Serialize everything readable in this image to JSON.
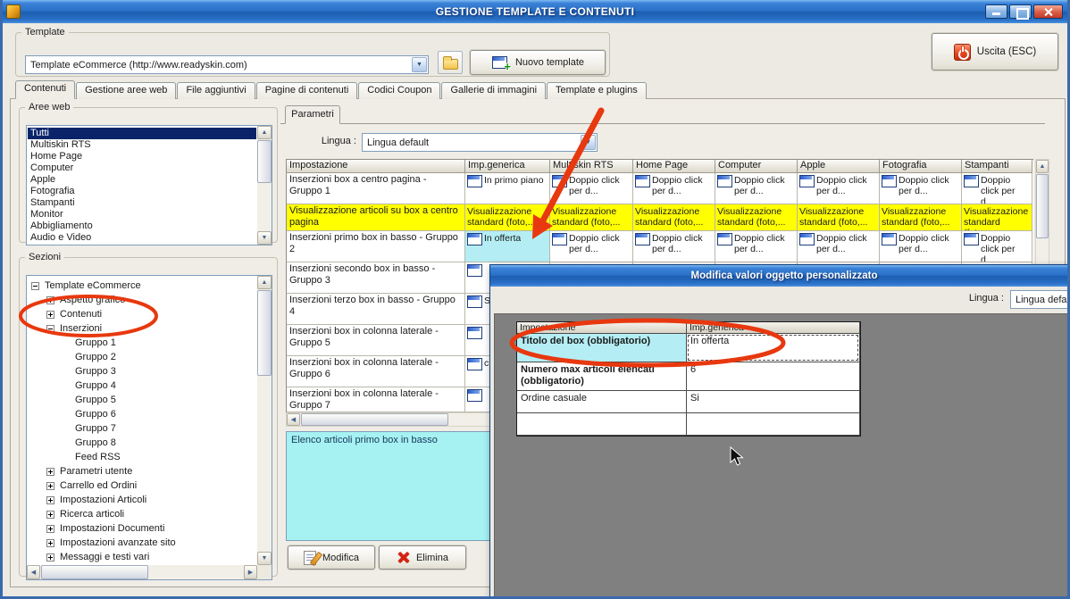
{
  "window": {
    "title": "GESTIONE TEMPLATE E CONTENUTI"
  },
  "toolbar": {
    "template_label": "Template",
    "template_value": "Template eCommerce (http://www.readyskin.com)",
    "new_template_label": "Nuovo template",
    "exit_label": "Uscita (ESC)"
  },
  "tabs": [
    "Contenuti",
    "Gestione aree web",
    "File aggiuntivi",
    "Pagine di contenuti",
    "Codici Coupon",
    "Gallerie di immagini",
    "Template e plugins"
  ],
  "active_tab": "Contenuti",
  "aree_web": {
    "legend": "Aree web",
    "selected": "Tutti",
    "items": [
      "Tutti",
      "Multiskin RTS",
      "Home Page",
      "Computer",
      "Apple",
      "Fotografia",
      "Stampanti",
      "Monitor",
      "Abbigliamento",
      "Audio e Video"
    ]
  },
  "sezioni": {
    "legend": "Sezioni",
    "tree": [
      {
        "label": "Template eCommerce",
        "level": 0,
        "toggle": "-"
      },
      {
        "label": "Aspetto grafico",
        "level": 1,
        "toggle": "+"
      },
      {
        "label": "Contenuti",
        "level": 1,
        "toggle": "+"
      },
      {
        "label": "Inserzioni",
        "level": 1,
        "toggle": "-"
      },
      {
        "label": "Gruppo 1",
        "level": 2,
        "toggle": ""
      },
      {
        "label": "Gruppo 2",
        "level": 2,
        "toggle": ""
      },
      {
        "label": "Gruppo 3",
        "level": 2,
        "toggle": ""
      },
      {
        "label": "Gruppo 4",
        "level": 2,
        "toggle": ""
      },
      {
        "label": "Gruppo 5",
        "level": 2,
        "toggle": ""
      },
      {
        "label": "Gruppo 6",
        "level": 2,
        "toggle": ""
      },
      {
        "label": "Gruppo 7",
        "level": 2,
        "toggle": ""
      },
      {
        "label": "Gruppo 8",
        "level": 2,
        "toggle": ""
      },
      {
        "label": "Feed RSS",
        "level": 2,
        "toggle": ""
      },
      {
        "label": "Parametri utente",
        "level": 1,
        "toggle": "+"
      },
      {
        "label": "Carrello ed Ordini",
        "level": 1,
        "toggle": "+"
      },
      {
        "label": "Impostazioni Articoli",
        "level": 1,
        "toggle": "+"
      },
      {
        "label": "Ricerca articoli",
        "level": 1,
        "toggle": "+"
      },
      {
        "label": "Impostazioni Documenti",
        "level": 1,
        "toggle": "+"
      },
      {
        "label": "Impostazioni avanzate sito",
        "level": 1,
        "toggle": "+"
      },
      {
        "label": "Messaggi e testi vari",
        "level": 1,
        "toggle": "+"
      }
    ]
  },
  "parametri": {
    "tab_label": "Parametri",
    "lingua_label": "Lingua :",
    "lingua_value": "Lingua default",
    "table": {
      "headers": [
        "Impostazione",
        "Imp.generica",
        "Multiskin RTS",
        "Home Page",
        "Computer",
        "Apple",
        "Fotografia",
        "Stampanti"
      ],
      "rows": [
        {
          "name": "Inserzioni box a centro pagina - Gruppo 1",
          "cells": [
            {
              "icon": true,
              "text": "In primo piano"
            },
            {
              "icon": true,
              "text": "Doppio click per d..."
            },
            {
              "icon": true,
              "text": "Doppio click per d..."
            },
            {
              "icon": true,
              "text": "Doppio click per d..."
            },
            {
              "icon": true,
              "text": "Doppio click per d..."
            },
            {
              "icon": true,
              "text": "Doppio click per d..."
            },
            {
              "icon": true,
              "text": "Doppio click per d..."
            }
          ]
        },
        {
          "name": "Visualizzazione articoli su box a centro pagina",
          "row_bg": "#ffff00",
          "cells": [
            {
              "icon": false,
              "text": "Visualizzazione standard (foto,..."
            },
            {
              "icon": false,
              "text": "Visualizzazione standard (foto,..."
            },
            {
              "icon": false,
              "text": "Visualizzazione standard (foto,..."
            },
            {
              "icon": false,
              "text": "Visualizzazione standard (foto,..."
            },
            {
              "icon": false,
              "text": "Visualizzazione standard (foto,..."
            },
            {
              "icon": false,
              "text": "Visualizzazione standard (foto,..."
            },
            {
              "icon": false,
              "text": "Visualizzazione standard (foto,..."
            }
          ]
        },
        {
          "name": "Inserzioni primo box in basso - Gruppo 2",
          "cells": [
            {
              "icon": true,
              "text": "In offerta",
              "bg": "#b4eef4"
            },
            {
              "icon": true,
              "text": "Doppio click per d..."
            },
            {
              "icon": true,
              "text": "Doppio click per d..."
            },
            {
              "icon": true,
              "text": "Doppio click per d..."
            },
            {
              "icon": true,
              "text": "Doppio click per d..."
            },
            {
              "icon": true,
              "text": "Doppio click per d..."
            },
            {
              "icon": true,
              "text": "Doppio click per d..."
            }
          ]
        },
        {
          "name": "Inserzioni secondo box in basso - Gruppo 3",
          "cells": [
            {
              "icon": true,
              "text": ""
            },
            {
              "icon": false,
              "text": ""
            },
            {
              "icon": false,
              "text": ""
            },
            {
              "icon": false,
              "text": ""
            },
            {
              "icon": false,
              "text": ""
            },
            {
              "icon": false,
              "text": ""
            },
            {
              "icon": false,
              "text": ""
            }
          ]
        },
        {
          "name": "Inserzioni terzo box in basso - Gruppo 4",
          "cells": [
            {
              "icon": true,
              "text": "Sof..."
            },
            {
              "icon": false,
              "text": ""
            },
            {
              "icon": false,
              "text": ""
            },
            {
              "icon": false,
              "text": ""
            },
            {
              "icon": false,
              "text": ""
            },
            {
              "icon": false,
              "text": ""
            },
            {
              "icon": false,
              "text": ""
            }
          ]
        },
        {
          "name": "Inserzioni box in colonna laterale - Gruppo 5",
          "cells": [
            {
              "icon": true,
              "text": ""
            },
            {
              "icon": false,
              "text": ""
            },
            {
              "icon": false,
              "text": ""
            },
            {
              "icon": false,
              "text": ""
            },
            {
              "icon": false,
              "text": ""
            },
            {
              "icon": false,
              "text": ""
            },
            {
              "icon": false,
              "text": ""
            }
          ]
        },
        {
          "name": "Inserzioni box in colonna laterale - Gruppo 6",
          "cells": [
            {
              "icon": true,
              "text": "click..."
            },
            {
              "icon": false,
              "text": ""
            },
            {
              "icon": false,
              "text": ""
            },
            {
              "icon": false,
              "text": ""
            },
            {
              "icon": false,
              "text": ""
            },
            {
              "icon": false,
              "text": ""
            },
            {
              "icon": false,
              "text": ""
            }
          ]
        },
        {
          "name": "Inserzioni box in colonna laterale - Gruppo 7",
          "cells": [
            {
              "icon": true,
              "text": ""
            },
            {
              "icon": false,
              "text": ""
            },
            {
              "icon": false,
              "text": ""
            },
            {
              "icon": false,
              "text": ""
            },
            {
              "icon": false,
              "text": ""
            },
            {
              "icon": false,
              "text": ""
            },
            {
              "icon": false,
              "text": ""
            }
          ]
        }
      ]
    },
    "description": "Elenco articoli primo box in basso",
    "modifica_label": "Modifica",
    "elimina_label": "Elimina"
  },
  "dialog": {
    "title": "Modifica valori oggetto personalizzato",
    "lingua_label": "Lingua :",
    "lingua_value": "Lingua default",
    "table": {
      "headers": [
        "Impostazione",
        "Imp.generica"
      ],
      "rows": [
        {
          "name": "Titolo del box (obbligatorio)",
          "value": "In offerta",
          "bold": true,
          "highlight": true
        },
        {
          "name": "Numero max articoli elencati (obbligatorio)",
          "value": "6",
          "bold": true,
          "highlight": false
        },
        {
          "name": "Ordine casuale",
          "value": "Si",
          "bold": false,
          "highlight": false
        }
      ]
    }
  },
  "colors": {
    "annotation": "#e8380f",
    "row_highlight_yellow": "#ffff00",
    "cell_highlight_cyan": "#b4eef4",
    "info_box_cyan": "#a6f2f2",
    "selection_navy": "#0a246a"
  }
}
